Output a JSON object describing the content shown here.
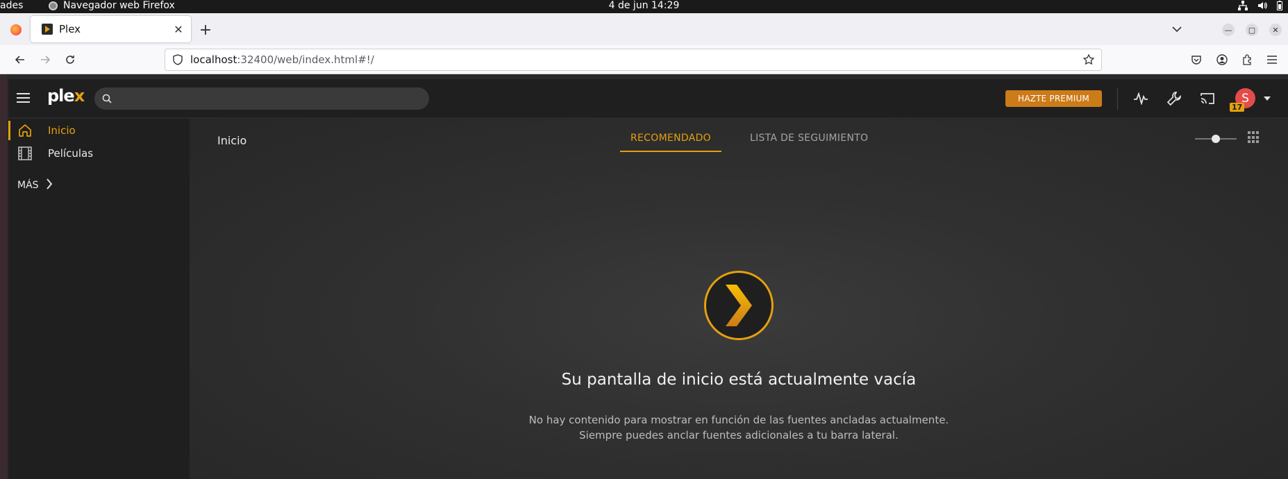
{
  "system_bar": {
    "activities_label": "ades",
    "app_label": "Navegador web Firefox",
    "clock": "4 de jun  14:29"
  },
  "browser": {
    "tab_title": "Plex",
    "url_host": "localhost",
    "url_rest": ":32400/web/index.html#!/"
  },
  "plex": {
    "search_placeholder": "",
    "premium_label": "HAZTE PREMIUM",
    "avatar_initial": "S",
    "notification_count": "17",
    "accent_color": "#e5a00d"
  },
  "sidebar": {
    "items": [
      {
        "label": "Inicio",
        "icon": "home-icon",
        "active": true
      },
      {
        "label": "Películas",
        "icon": "film-icon",
        "active": false
      }
    ],
    "more_label": "MÁS"
  },
  "main": {
    "breadcrumb": "Inicio",
    "tabs": [
      {
        "label": "RECOMENDADO",
        "active": true
      },
      {
        "label": "LISTA DE SEGUIMIENTO",
        "active": false
      }
    ],
    "empty_title": "Su pantalla de inicio está actualmente vacía",
    "empty_text": "No hay contenido para mostrar en función de las fuentes ancladas actualmente. Siempre puedes anclar fuentes adicionales a tu barra lateral."
  }
}
